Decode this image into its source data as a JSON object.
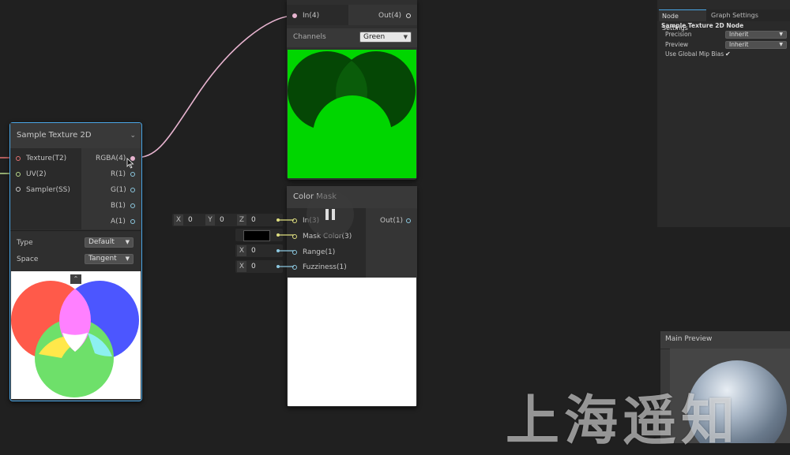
{
  "sample_texture": {
    "title": "Sample Texture 2D",
    "inputs": [
      "Texture(T2)",
      "UV(2)",
      "Sampler(SS)"
    ],
    "outputs": [
      "RGBA(4)",
      "R(1)",
      "G(1)",
      "B(1)",
      "A(1)"
    ],
    "type_label": "Type",
    "type_value": "Default",
    "space_label": "Space",
    "space_value": "Tangent"
  },
  "channel_node": {
    "input": "In(4)",
    "output": "Out(4)",
    "channels_label": "Channels",
    "channels_value": "Green"
  },
  "color_mask": {
    "title": "Color Mask",
    "inputs": [
      "In(3)",
      "Mask Color(3)",
      "Range(1)",
      "Fuzziness(1)"
    ],
    "output": "Out(1)",
    "in_fields": {
      "x_axis": "X",
      "x_val": "0",
      "y_axis": "Y",
      "y_val": "0",
      "z_axis": "Z",
      "z_val": "0"
    },
    "range_field": {
      "axis": "X",
      "val": "0"
    },
    "fuzz_field": {
      "axis": "X",
      "val": "0"
    }
  },
  "inspector": {
    "tabs": [
      "Node Settings",
      "Graph Settings"
    ],
    "section": "Sample Texture 2D Node",
    "precision_label": "Precision",
    "precision_value": "Inherit",
    "preview_label": "Preview",
    "preview_value": "Inherit",
    "mip_label": "Use Global Mip Bias",
    "mip_check": "✔"
  },
  "main_preview": {
    "title": "Main Preview"
  },
  "watermark": "上海遥知",
  "colors": {
    "canvas": "#202020",
    "node": "#2f2f2f",
    "selection": "#4aa6e6",
    "preview_green": "#00d600",
    "edge": "#e8b4d0"
  }
}
